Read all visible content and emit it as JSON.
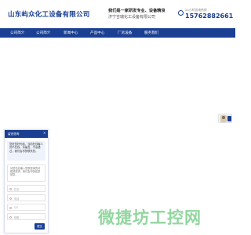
{
  "header": {
    "company_name": "山东屿众化工设备有限公司",
    "slogan": "我们是一家研发专业、设备精良",
    "company_sub": "济宁吉瑞化工设备有限公司",
    "hotline_label": "24小时咨询热线",
    "phone": "15762882661"
  },
  "nav": {
    "items": [
      "公司简介",
      "公司简介",
      "新闻中心",
      "产品中心",
      "厂房设备",
      "服务我们"
    ]
  },
  "chat": {
    "title": "留言咨询",
    "close": "×",
    "greeting": "您好您好光临，当前在线客人员不在线，请留言，不会错过，我们会尽快联系您。",
    "textarea_placeholder": "请您在此输入您想咨询的问题或需求，我们会尽快给您回复。",
    "fields": [
      "姓名",
      "电话",
      "QQ",
      "邮箱"
    ],
    "submit": "提交"
  },
  "watermark": "微捷坊工控网",
  "colors": {
    "brand": "#1a3f93",
    "watermark": "#7fcf8f"
  }
}
